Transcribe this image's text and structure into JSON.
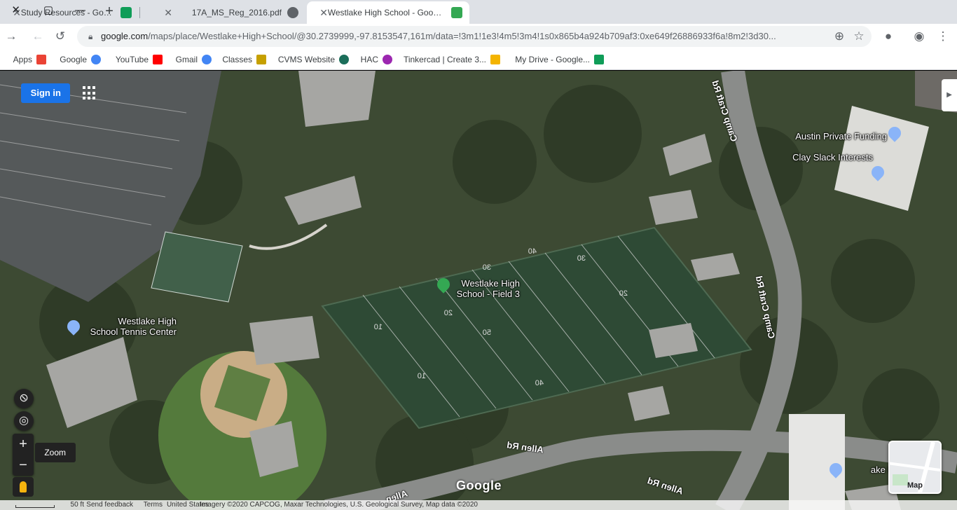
{
  "browser": {
    "window_controls": {
      "minimize": "—",
      "maximize": "▢",
      "close": "✕"
    },
    "tabs": [
      {
        "title": "Study Resources - Google Sheets",
        "close": "✕",
        "favicon_color": "#0f9d58",
        "active": false
      },
      {
        "title": "17A_MS_Reg_2016.pdf",
        "close": "✕",
        "favicon_color": "#5f6368",
        "active": false
      },
      {
        "title": "Westlake High School - Google M",
        "close": "✕",
        "favicon_color": "#34a853",
        "active": true
      }
    ],
    "new_tab": "+",
    "address_bar": {
      "host": "google.com",
      "path": "/maps/place/Westlake+High+School/@30.2739999,-97.8153547,161m/data=!3m1!1e3!4m5!3m4!1s0x865b4a924b709af3:0xe649f26886933f6a!8m2!3d30..."
    },
    "bookmarks": [
      {
        "label": "Apps",
        "icon_color": "#ea4335"
      },
      {
        "label": "Google",
        "icon_color": "#4285f4"
      },
      {
        "label": "YouTube",
        "icon_color": "#ff0000"
      },
      {
        "label": "Gmail",
        "icon_color": "#4285f4"
      },
      {
        "label": "Classes",
        "icon_color": "#c6a000"
      },
      {
        "label": "CVMS Website",
        "icon_color": "#1b6e5a"
      },
      {
        "label": "HAC",
        "icon_color": "#9c27b0"
      },
      {
        "label": "Tinkercad | Create 3...",
        "icon_color": "#f4b400"
      },
      {
        "label": "My Drive - Google...",
        "icon_color": "#0f9d58"
      }
    ]
  },
  "map": {
    "sign_in": "Sign in",
    "places": [
      {
        "name": "Westlake High School - Field 3",
        "line1": "Westlake High",
        "line2": "School - Field 3",
        "pin_color": "#34a853"
      },
      {
        "name": "Westlake High School Tennis Center",
        "line1": "Westlake High",
        "line2": "School Tennis Center",
        "pin_color": "#8ab4f8"
      },
      {
        "name": "Austin Private Funding",
        "pin_color": "#8ab4f8"
      },
      {
        "name": "Clay Slack Interests",
        "pin_color": "#8ab4f8"
      },
      {
        "name": "ake Place",
        "pin_color": "#8ab4f8"
      }
    ],
    "roads": {
      "camp_craft_top": "Camp Craft Rd",
      "camp_craft_mid": "Camp Craft Rd",
      "allen_1": "Allen Rd",
      "allen_2": "Allen Rd",
      "allen_3": "Allen"
    },
    "field_yard_numbers": [
      "10",
      "20",
      "30",
      "40",
      "50",
      "40",
      "30",
      "20",
      "10"
    ],
    "controls": {
      "zoom_in": "+",
      "zoom_out": "−",
      "zoom_tooltip": "Zoom"
    },
    "layer_toggle": "Map",
    "logo": "Google",
    "footer": {
      "imagery": "Imagery ©2020 CAPCOG, Maxar Technologies, U.S. Geological Survey, Map data ©2020",
      "country": "United States",
      "terms": "Terms",
      "feedback": "Send feedback",
      "scale": "50 ft"
    }
  }
}
